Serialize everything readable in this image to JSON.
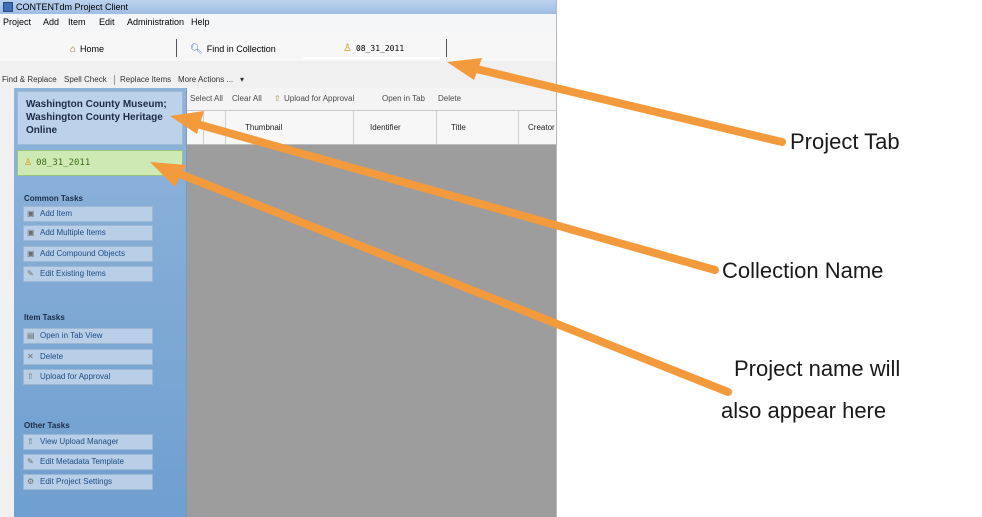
{
  "app": {
    "title": "CONTENTdm Project Client",
    "menu": [
      "Project",
      "Add",
      "Item",
      "Edit",
      "Administration",
      "Help"
    ]
  },
  "tabs": [
    {
      "label": "Home",
      "icon": "home-icon"
    },
    {
      "label": "Find in Collection",
      "icon": "search-icon"
    },
    {
      "label": "08_31_2011",
      "icon": "project-icon"
    }
  ],
  "toolbar": [
    "Find & Replace",
    "Spell Check",
    "Replace Items",
    "More Actions ..."
  ],
  "sidebar": {
    "collection_name": "Washington County Museum; Washington County Heritage Online",
    "project_name": "08_31_2011",
    "common_title": "Common Tasks",
    "common_tasks": [
      "Add Item",
      "Add Multiple Items",
      "Add Compound Objects",
      "Edit Existing Items"
    ],
    "item_title": "Item Tasks",
    "item_tasks": [
      "Open in Tab View",
      "Delete",
      "Upload for Approval"
    ],
    "other_title": "Other Tasks",
    "other_tasks": [
      "View Upload Manager",
      "Edit Metadata Template",
      "Edit Project Settings"
    ]
  },
  "grid": {
    "toolbar": [
      "Select All",
      "Clear All",
      "Upload for Approval",
      "Open in Tab",
      "Delete"
    ],
    "columns": [
      "Thumbnail",
      "Identifier",
      "Title",
      "Creator"
    ]
  },
  "annotations": {
    "project_tab": "Project Tab",
    "collection_name": "Collection Name",
    "project_name_line1": "Project name will",
    "project_name_line2": "also appear here"
  },
  "colors": {
    "arrow": "#f39a3c",
    "sidebar": "#7aa7d6",
    "grid_bg": "#9d9d9d"
  }
}
